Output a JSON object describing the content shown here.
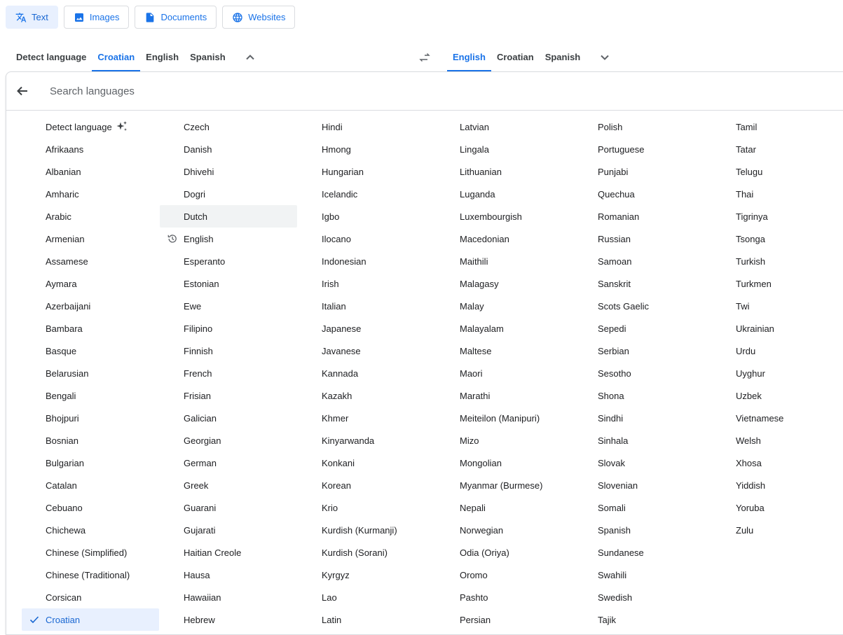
{
  "mode_tabs": [
    {
      "label": "Text",
      "icon": "translate-icon",
      "active": true
    },
    {
      "label": "Images",
      "icon": "image-icon",
      "active": false
    },
    {
      "label": "Documents",
      "icon": "document-icon",
      "active": false
    },
    {
      "label": "Websites",
      "icon": "globe-icon",
      "active": false
    }
  ],
  "source_langs": [
    {
      "label": "Detect language",
      "selected": false
    },
    {
      "label": "Croatian",
      "selected": true
    },
    {
      "label": "English",
      "selected": false
    },
    {
      "label": "Spanish",
      "selected": false
    }
  ],
  "target_langs": [
    {
      "label": "English",
      "selected": true
    },
    {
      "label": "Croatian",
      "selected": false
    },
    {
      "label": "Spanish",
      "selected": false
    }
  ],
  "search": {
    "placeholder": "Search languages"
  },
  "colors": {
    "accent": "#1a73e8",
    "selected_bg": "#e8f0fe",
    "hover_bg": "#f1f3f4"
  },
  "languages": [
    [
      "Detect language",
      "Afrikaans",
      "Albanian",
      "Amharic",
      "Arabic",
      "Armenian",
      "Assamese",
      "Aymara",
      "Azerbaijani",
      "Bambara",
      "Basque",
      "Belarusian",
      "Bengali",
      "Bhojpuri",
      "Bosnian",
      "Bulgarian",
      "Catalan",
      "Cebuano",
      "Chichewa",
      "Chinese (Simplified)",
      "Chinese (Traditional)",
      "Corsican",
      "Croatian"
    ],
    [
      "Czech",
      "Danish",
      "Dhivehi",
      "Dogri",
      "Dutch",
      "English",
      "Esperanto",
      "Estonian",
      "Ewe",
      "Filipino",
      "Finnish",
      "French",
      "Frisian",
      "Galician",
      "Georgian",
      "German",
      "Greek",
      "Guarani",
      "Gujarati",
      "Haitian Creole",
      "Hausa",
      "Hawaiian",
      "Hebrew"
    ],
    [
      "Hindi",
      "Hmong",
      "Hungarian",
      "Icelandic",
      "Igbo",
      "Ilocano",
      "Indonesian",
      "Irish",
      "Italian",
      "Japanese",
      "Javanese",
      "Kannada",
      "Kazakh",
      "Khmer",
      "Kinyarwanda",
      "Konkani",
      "Korean",
      "Krio",
      "Kurdish (Kurmanji)",
      "Kurdish (Sorani)",
      "Kyrgyz",
      "Lao",
      "Latin"
    ],
    [
      "Latvian",
      "Lingala",
      "Lithuanian",
      "Luganda",
      "Luxembourgish",
      "Macedonian",
      "Maithili",
      "Malagasy",
      "Malay",
      "Malayalam",
      "Maltese",
      "Maori",
      "Marathi",
      "Meiteilon (Manipuri)",
      "Mizo",
      "Mongolian",
      "Myanmar (Burmese)",
      "Nepali",
      "Norwegian",
      "Odia (Oriya)",
      "Oromo",
      "Pashto",
      "Persian"
    ],
    [
      "Polish",
      "Portuguese",
      "Punjabi",
      "Quechua",
      "Romanian",
      "Russian",
      "Samoan",
      "Sanskrit",
      "Scots Gaelic",
      "Sepedi",
      "Serbian",
      "Sesotho",
      "Shona",
      "Sindhi",
      "Sinhala",
      "Slovak",
      "Slovenian",
      "Somali",
      "Spanish",
      "Sundanese",
      "Swahili",
      "Swedish",
      "Tajik"
    ],
    [
      "Tamil",
      "Tatar",
      "Telugu",
      "Thai",
      "Tigrinya",
      "Tsonga",
      "Turkish",
      "Turkmen",
      "Twi",
      "Ukrainian",
      "Urdu",
      "Uyghur",
      "Uzbek",
      "Vietnamese",
      "Welsh",
      "Xhosa",
      "Yiddish",
      "Yoruba",
      "Zulu"
    ]
  ],
  "list_state": {
    "selected": "Croatian",
    "hovered": "Dutch",
    "recent": "English",
    "detect_icon": "sparkle-icon",
    "selected_icon": "check-icon",
    "recent_icon": "history-icon"
  }
}
